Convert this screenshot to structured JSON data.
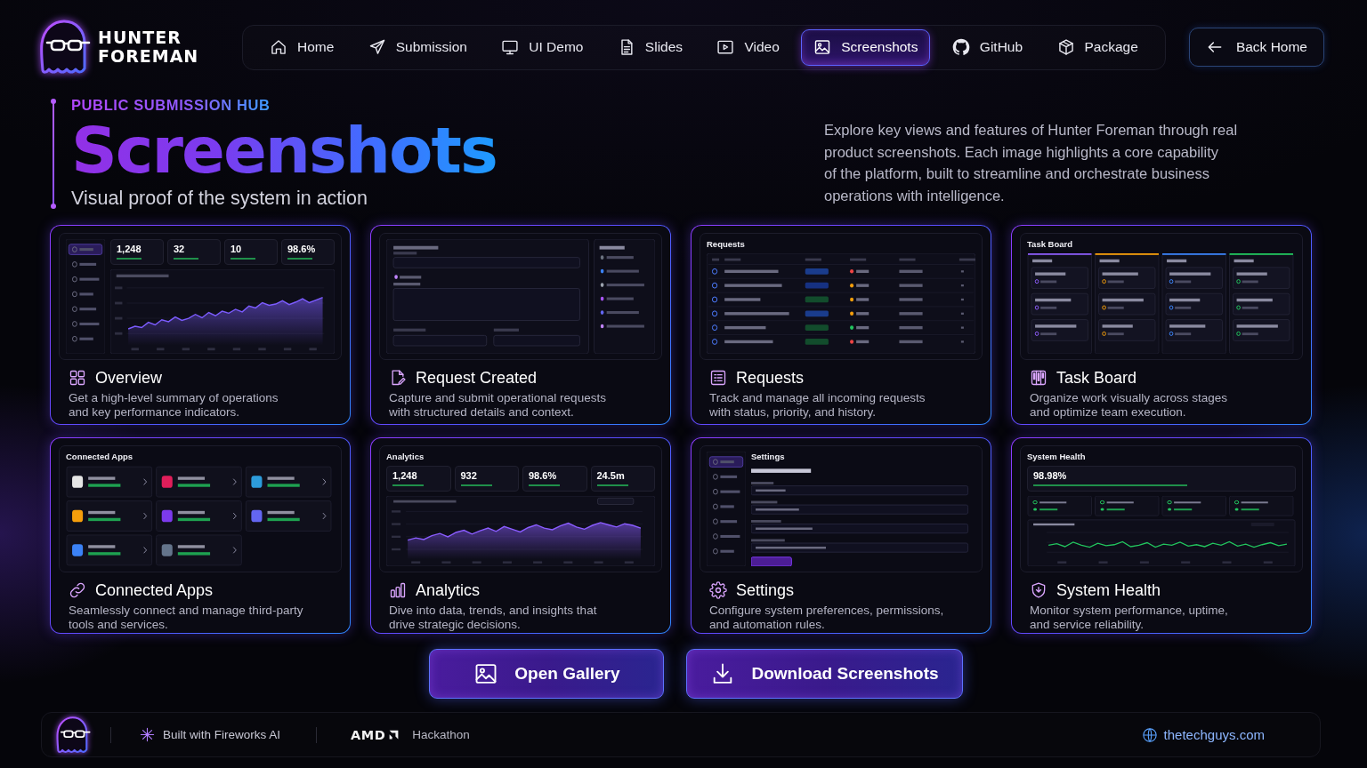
{
  "brand": {
    "name": "HUNTER FOREMAN"
  },
  "nav": {
    "items": [
      {
        "label": "Home",
        "selected": false
      },
      {
        "label": "Submission",
        "selected": false
      },
      {
        "label": "UI Demo",
        "selected": false
      },
      {
        "label": "Slides",
        "selected": false
      },
      {
        "label": "Video",
        "selected": false
      },
      {
        "label": "Screenshots",
        "selected": true
      },
      {
        "label": "GitHub",
        "selected": false
      },
      {
        "label": "Package",
        "selected": false
      }
    ]
  },
  "back_button": {
    "label": "Back Home"
  },
  "hero": {
    "eyebrow": "PUBLIC SUBMISSION HUB",
    "title": "Screenshots",
    "subtitle": "Visual proof of the system in action",
    "description": "Explore key views and features of Hunter Foreman through real\nproduct screenshots. Each image highlights a core capability\nof the platform, built to streamline and orchestrate business\noperations with intelligence."
  },
  "cards": [
    {
      "title": "Overview",
      "description": "Get a high-level summary of operations\nand key performance indicators.",
      "preview": {
        "kind": "dashboard",
        "stats": [
          "1,248",
          "32",
          "10",
          "98.6%"
        ]
      }
    },
    {
      "title": "Request Created",
      "description": "Capture and submit operational requests\nwith structured details and context.",
      "preview": {
        "kind": "form"
      }
    },
    {
      "title": "Requests",
      "description": "Track and manage all incoming requests\nwith status, priority, and history.",
      "preview": {
        "kind": "table",
        "title": "Requests"
      }
    },
    {
      "title": "Task Board",
      "description": "Organize work visually across stages\nand optimize team execution.",
      "preview": {
        "kind": "board",
        "title": "Task Board"
      }
    },
    {
      "title": "Connected Apps",
      "description": "Seamlessly connect and manage third-party\ntools and services.",
      "preview": {
        "kind": "apps",
        "title": "Connected Apps"
      }
    },
    {
      "title": "Analytics",
      "description": "Dive into data, trends, and insights that\ndrive strategic decisions.",
      "preview": {
        "kind": "analytics",
        "title": "Analytics",
        "stats": [
          "1,248",
          "932",
          "98.6%",
          "24.5m"
        ]
      }
    },
    {
      "title": "Settings",
      "description": "Configure system preferences, permissions,\nand automation rules.",
      "preview": {
        "kind": "settings",
        "title": "Settings"
      }
    },
    {
      "title": "System Health",
      "description": "Monitor system performance, uptime,\nand service reliability.",
      "preview": {
        "kind": "health",
        "title": "System Health",
        "stats": [
          "98.98%"
        ]
      }
    }
  ],
  "actions": [
    {
      "label": "Open Gallery"
    },
    {
      "label": "Download Screenshots"
    }
  ],
  "footer": {
    "credit": "Built with Fireworks AI",
    "sponsor": "AMD",
    "event": "Hackathon",
    "link": "thetechguys.com"
  }
}
